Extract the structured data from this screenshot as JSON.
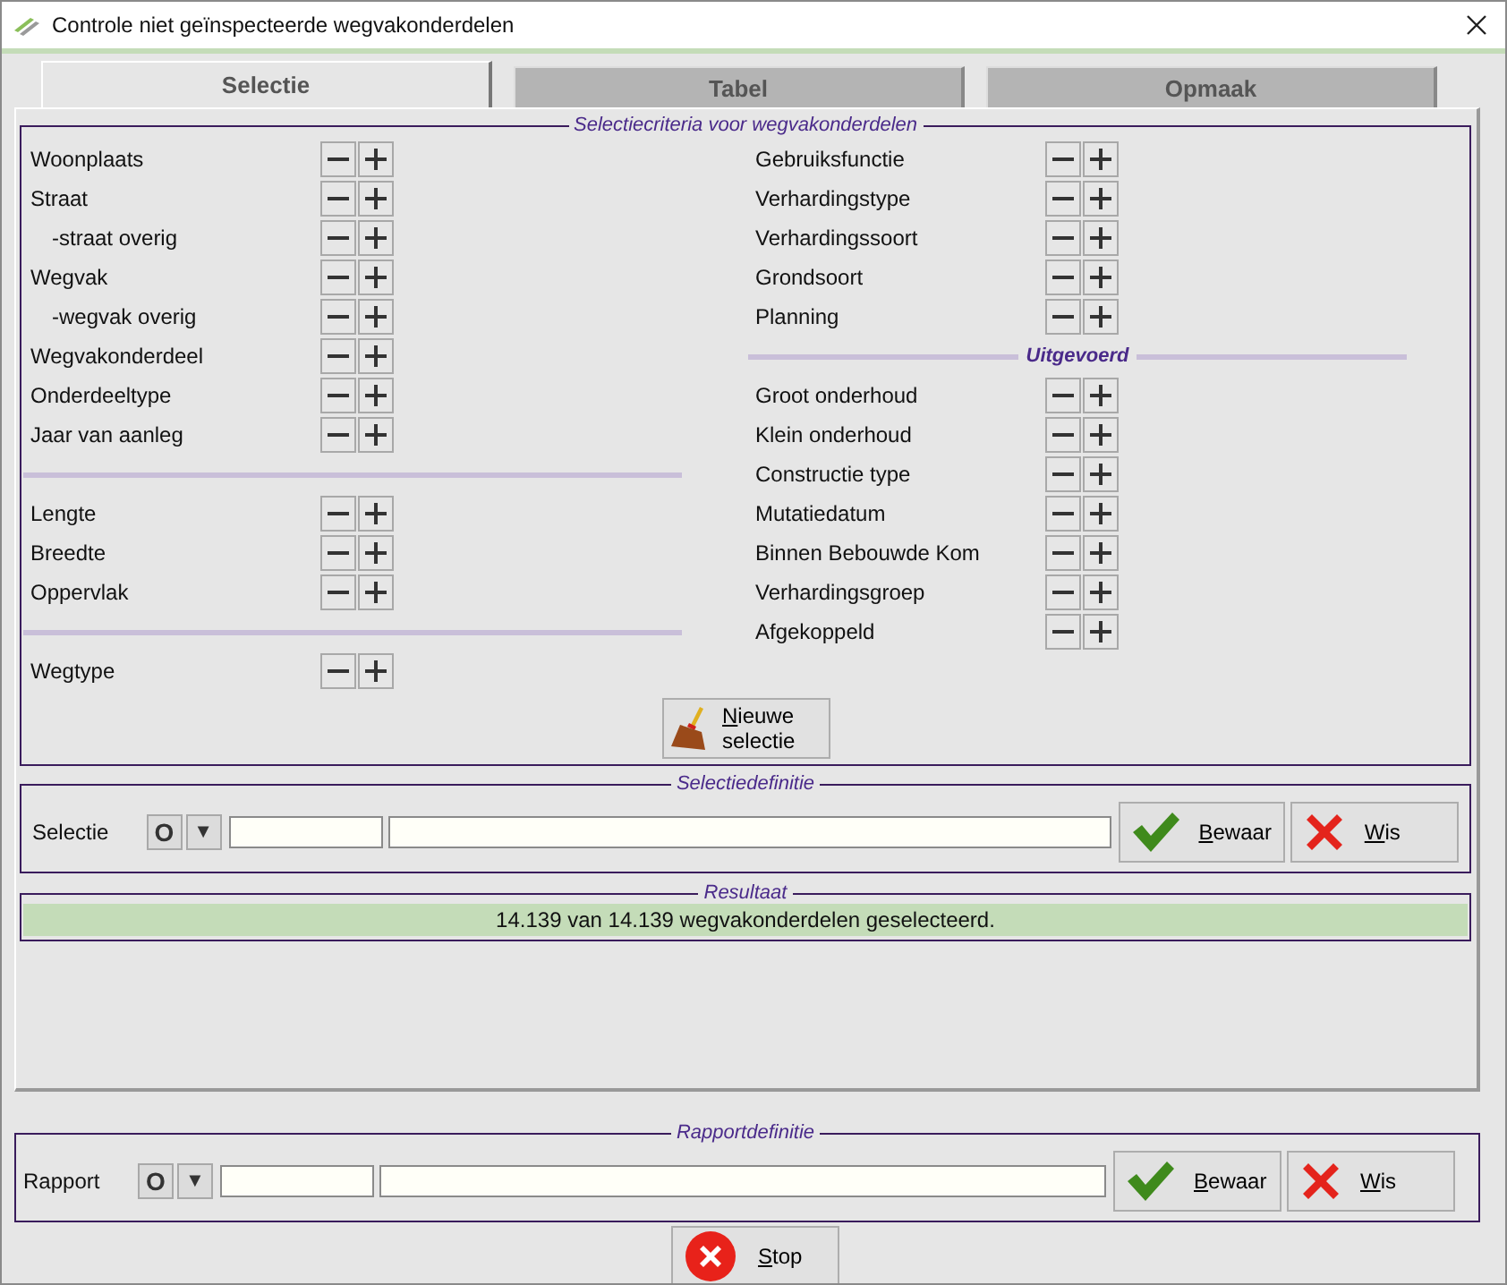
{
  "window": {
    "title": "Controle niet geïnspecteerde wegvakonderdelen"
  },
  "tabs": [
    {
      "label": "Selectie",
      "selected": true
    },
    {
      "label": "Tabel",
      "selected": false
    },
    {
      "label": "Opmaak",
      "selected": false
    }
  ],
  "criteria": {
    "legend": "Selectiecriteria voor wegvakonderdelen",
    "columns": [
      {
        "groups": [
          {
            "items": [
              {
                "label": "Woonplaats"
              },
              {
                "label": "Straat",
                "children": [
                  {
                    "label": "-straat overig"
                  }
                ]
              },
              {
                "label": "Wegvak",
                "children": [
                  {
                    "label": "-wegvak overig"
                  }
                ]
              },
              {
                "label": "Wegvakonderdeel"
              },
              {
                "label": "Onderdeeltype"
              },
              {
                "label": "Jaar van aanleg"
              }
            ]
          },
          {
            "items": [
              {
                "label": "Lengte"
              },
              {
                "label": "Breedte"
              },
              {
                "label": "Oppervlak"
              }
            ]
          },
          {
            "items": [
              {
                "label": "Wegtype"
              }
            ]
          }
        ]
      },
      {
        "groups": [
          {
            "items": [
              {
                "label": "Gebruiksfunctie"
              },
              {
                "label": "Verhardingstype"
              },
              {
                "label": "Verhardingssoort"
              },
              {
                "label": "Grondsoort"
              },
              {
                "label": "Planning"
              }
            ]
          },
          {
            "heading": "Uitgevoerd",
            "items": [
              {
                "label": "Groot onderhoud"
              },
              {
                "label": "Klein onderhoud"
              },
              {
                "label": "Constructie type"
              },
              {
                "label": "Mutatiedatum"
              },
              {
                "label": "Binnen Bebouwde Kom"
              },
              {
                "label": "Verhardingsgroep"
              },
              {
                "label": "Afgekoppeld"
              }
            ]
          }
        ]
      }
    ],
    "new_selection_button": "Nieuwe selectie"
  },
  "selection_definition": {
    "legend": "Selectiedefinitie",
    "label": "Selectie",
    "mode_button": "O",
    "dropdown_button": "▼",
    "buttons": [
      {
        "kind": "save",
        "label": "Bewaar"
      },
      {
        "kind": "clear",
        "label": "Wis"
      }
    ]
  },
  "result": {
    "legend": "Resultaat",
    "message": "14.139 van 14.139 wegvakonderdelen geselecteerd."
  },
  "report_definition": {
    "legend": "Rapportdefinitie",
    "label": "Rapport",
    "mode_button": "O",
    "dropdown_button": "▼",
    "buttons": [
      {
        "kind": "save",
        "label": "Bewaar"
      },
      {
        "kind": "clear",
        "label": "Wis"
      }
    ]
  },
  "stop_button": "Stop"
}
